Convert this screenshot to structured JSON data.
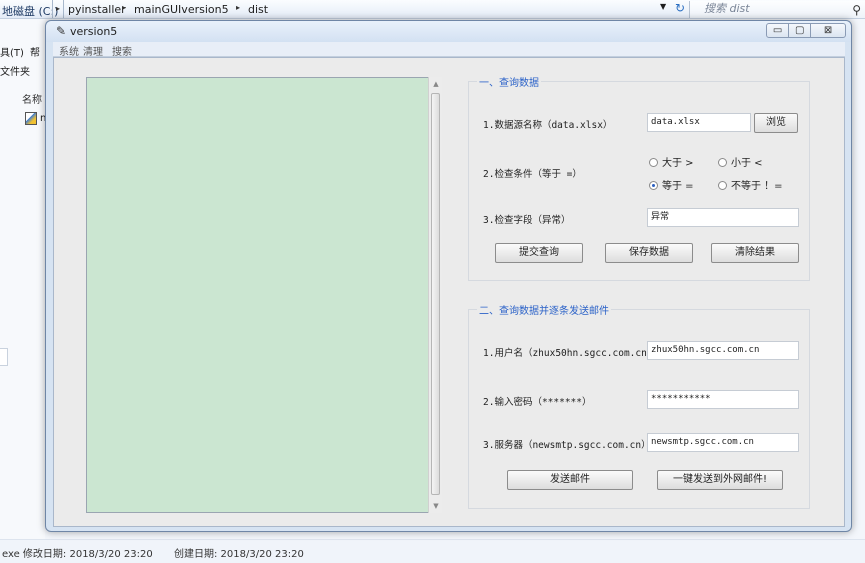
{
  "explorer": {
    "drive": "地磁盘 (C:)",
    "breadcrumbs": [
      "pyinstaller",
      "mainGUIversion5",
      "dist"
    ],
    "search_placeholder": "搜索 dist",
    "menu_tools": "具(T)",
    "menu_help": "帮",
    "sidebar_item": "文件夹",
    "column_name": "名称",
    "file_prefix": "n",
    "status_left": "exe 修改日期: 2018/3/20 23:20",
    "status_right": "创建日期: 2018/3/20 23:20"
  },
  "window": {
    "title": "version5",
    "menu": [
      "系统",
      "清理",
      "搜索"
    ],
    "buttons": {
      "minimize": "▭",
      "maximize": "▢",
      "close": "⊠"
    }
  },
  "query_group": {
    "title": "一、查询数据",
    "source_label": "1.数据源名称（data.xlsx）",
    "source_value": "data.xlsx",
    "browse": "浏览",
    "condition_label": "2.检查条件（等于 =）",
    "radios": [
      {
        "label": "大于 >",
        "checked": false
      },
      {
        "label": "小于 <",
        "checked": false
      },
      {
        "label": "等于 =",
        "checked": true
      },
      {
        "label": "不等于 ！=",
        "checked": false
      }
    ],
    "field_label": "3.检查字段（异常）",
    "field_value": "异常",
    "submit": "提交查询",
    "save": "保存数据",
    "clear": "清除结果"
  },
  "mail_group": {
    "title": "二、查询数据并逐条发送邮件",
    "user_label": "1.用户名（zhux50hn.sgcc.com.cn）",
    "user_value": "zhux50hn.sgcc.com.cn",
    "password_label": "2.输入密码（*******）",
    "password_value": "***********",
    "server_label": "3.服务器（newsmtp.sgcc.com.cn）",
    "server_value": "newsmtp.sgcc.com.cn",
    "send": "发送邮件",
    "send_external": "一键发送到外网邮件!"
  },
  "colors": {
    "textarea_bg": "#cbe6d1",
    "group_title": "#2b62c8"
  }
}
